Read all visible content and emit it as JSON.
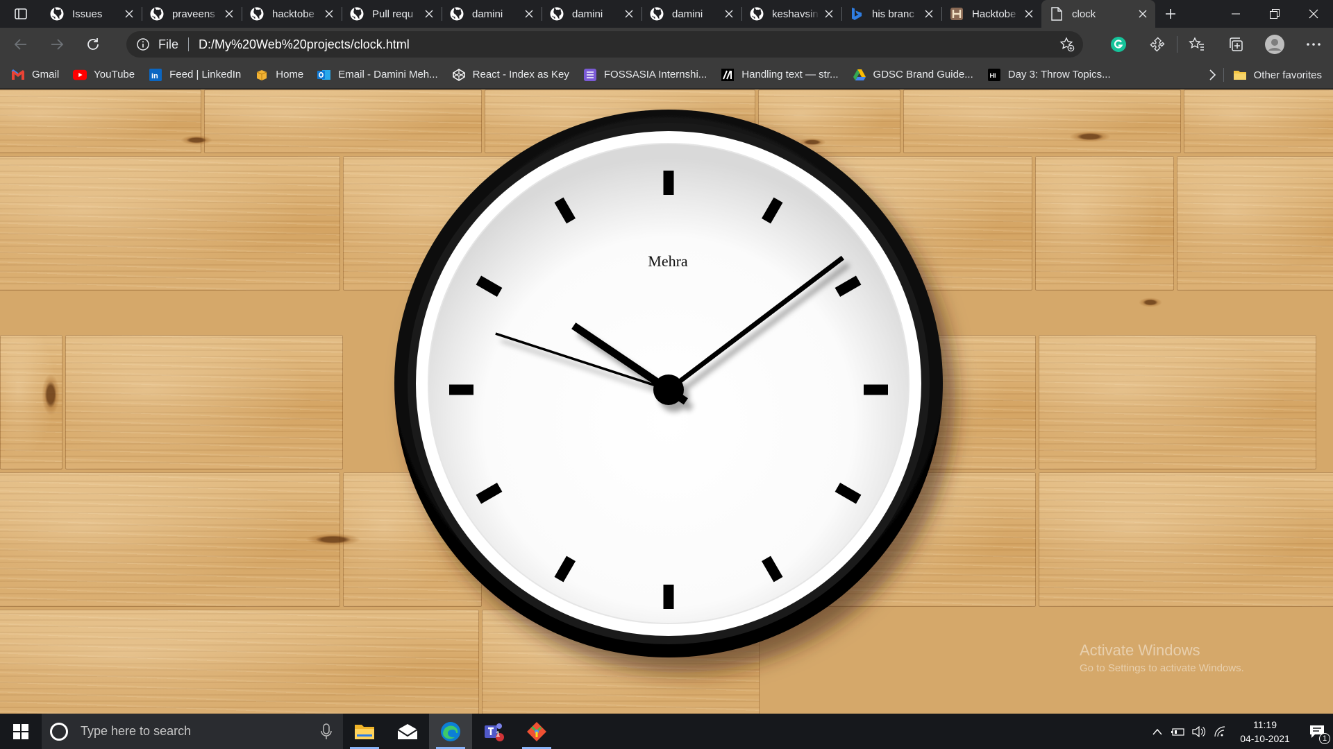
{
  "browser": {
    "tabs": [
      {
        "title": "Issues",
        "icon": "github-icon"
      },
      {
        "title": "praveens",
        "icon": "github-icon"
      },
      {
        "title": "hacktobe",
        "icon": "github-icon"
      },
      {
        "title": "Pull requ",
        "icon": "github-icon"
      },
      {
        "title": "damini",
        "icon": "github-icon"
      },
      {
        "title": "damini",
        "icon": "github-icon"
      },
      {
        "title": "damini",
        "icon": "github-icon"
      },
      {
        "title": "keshavsin",
        "icon": "github-icon"
      },
      {
        "title": "his branc",
        "icon": "bing-icon"
      },
      {
        "title": "Hacktobe",
        "icon": "hacktoberfest-icon"
      },
      {
        "title": "clock",
        "icon": "file-icon",
        "active": true
      }
    ],
    "address": {
      "scheme": "File",
      "url": "D:/My%20Web%20projects/clock.html"
    },
    "bookmarks": [
      {
        "label": "Gmail",
        "icon": "gmail-icon",
        "color": "#ea4335"
      },
      {
        "label": "YouTube",
        "icon": "youtube-icon",
        "color": "#ff0000"
      },
      {
        "label": "Feed | LinkedIn",
        "icon": "linkedin-icon",
        "color": "#0a66c2"
      },
      {
        "label": "Home",
        "icon": "box-icon",
        "color": "#f2b233"
      },
      {
        "label": "Email - Damini Meh...",
        "icon": "outlook-icon",
        "color": "#0f78d4"
      },
      {
        "label": "React - Index as Key",
        "icon": "codepen-icon",
        "color": "#ffffff"
      },
      {
        "label": "FOSSASIA Internshi...",
        "icon": "list-icon",
        "color": "#7b5bd6"
      },
      {
        "label": "Handling text — str...",
        "icon": "mdn-icon",
        "color": "#ffffff"
      },
      {
        "label": "GDSC Brand Guide...",
        "icon": "drive-icon",
        "color": "#34a853"
      },
      {
        "label": "Day 3: Throw Topics...",
        "icon": "hashnode-icon",
        "color": "#ffffff"
      }
    ],
    "other_favorites": "Other favorites"
  },
  "page": {
    "clock_brand": "Mehra",
    "clock_time": {
      "hours": 10,
      "minutes": 8,
      "seconds": 48
    },
    "watermark": {
      "title": "Activate Windows",
      "subtitle": "Go to Settings to activate Windows."
    }
  },
  "taskbar": {
    "search_placeholder": "Type here to search",
    "time": "11:19",
    "date": "04-10-2021",
    "teams_badge": "1",
    "notification_badge": "1",
    "apps": [
      "file-explorer-icon",
      "mail-icon",
      "edge-icon",
      "teams-icon",
      "git-icon"
    ]
  },
  "colors": {
    "tab_bg": "#202124",
    "toolbar_bg": "#3b3b3b",
    "wood": "#d5a86a",
    "clock_face": "#ffffff",
    "clock_ring": "#000000"
  }
}
